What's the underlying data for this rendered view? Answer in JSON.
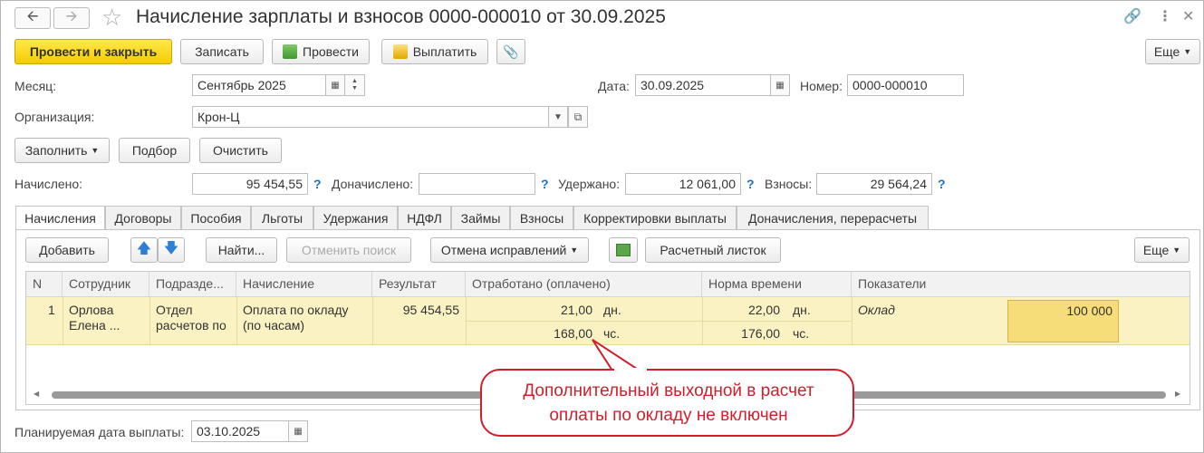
{
  "window": {
    "title": "Начисление зарплаты и взносов 0000-000010 от 30.09.2025",
    "back_icon": "arrow-left",
    "forward_icon": "arrow-right"
  },
  "toolbar": {
    "post_close": "Провести и закрыть",
    "save": "Записать",
    "post": "Провести",
    "pay": "Выплатить",
    "more": "Еще"
  },
  "header": {
    "month_label": "Месяц:",
    "month_value": "Сентябрь 2025",
    "date_label": "Дата:",
    "date_value": "30.09.2025",
    "number_label": "Номер:",
    "number_value": "0000-000010",
    "org_label": "Организация:",
    "org_value": "Крон-Ц"
  },
  "actions": {
    "fill": "Заполнить",
    "select": "Подбор",
    "clear": "Очистить"
  },
  "totals": {
    "accrued_label": "Начислено:",
    "accrued_value": "95 454,55",
    "additional_label": "Доначислено:",
    "additional_value": "",
    "withheld_label": "Удержано:",
    "withheld_value": "12 061,00",
    "contributions_label": "Взносы:",
    "contributions_value": "29 564,24",
    "help": "?"
  },
  "tabs": [
    {
      "label": "Начисления"
    },
    {
      "label": "Договоры"
    },
    {
      "label": "Пособия"
    },
    {
      "label": "Льготы"
    },
    {
      "label": "Удержания"
    },
    {
      "label": "НДФЛ"
    },
    {
      "label": "Займы"
    },
    {
      "label": "Взносы"
    },
    {
      "label": "Корректировки выплаты"
    },
    {
      "label": "Доначисления, перерасчеты"
    }
  ],
  "tab_toolbar": {
    "add": "Добавить",
    "find": "Найти...",
    "cancel_search": "Отменить поиск",
    "cancel_corrections": "Отмена исправлений",
    "payslip": "Расчетный листок",
    "more": "Еще"
  },
  "table": {
    "columns": [
      "N",
      "Сотрудник",
      "Подразде...",
      "Начисление",
      "Результат",
      "Отработано (оплачено)",
      "Норма времени",
      "Показатели"
    ],
    "row": {
      "n": "1",
      "employee_1": "Орлова",
      "employee_2": "Елена ...",
      "dept_1": "Отдел",
      "dept_2": "расчетов по",
      "accrual_1": "Оплата по окладу",
      "accrual_2": "(по часам)",
      "result": "95 454,55",
      "worked_days": "21,00",
      "worked_days_unit": "дн.",
      "worked_hours": "168,00",
      "worked_hours_unit": "чс.",
      "norm_days": "22,00",
      "norm_days_unit": "дн.",
      "norm_hours": "176,00",
      "norm_hours_unit": "чс.",
      "indicator_name": "Оклад",
      "indicator_value": "100 000"
    }
  },
  "footer": {
    "planned_date_label": "Планируемая дата выплаты:",
    "planned_date_value": "03.10.2025"
  },
  "callout": {
    "line1": "Дополнительный выходной в расчет",
    "line2": "оплаты по окладу не включен",
    "color": "#d01f2a"
  },
  "colors": {
    "primary_button": "#f5cc00",
    "row_highlight": "#fbf2c4",
    "help_link": "#1a6fc4"
  }
}
